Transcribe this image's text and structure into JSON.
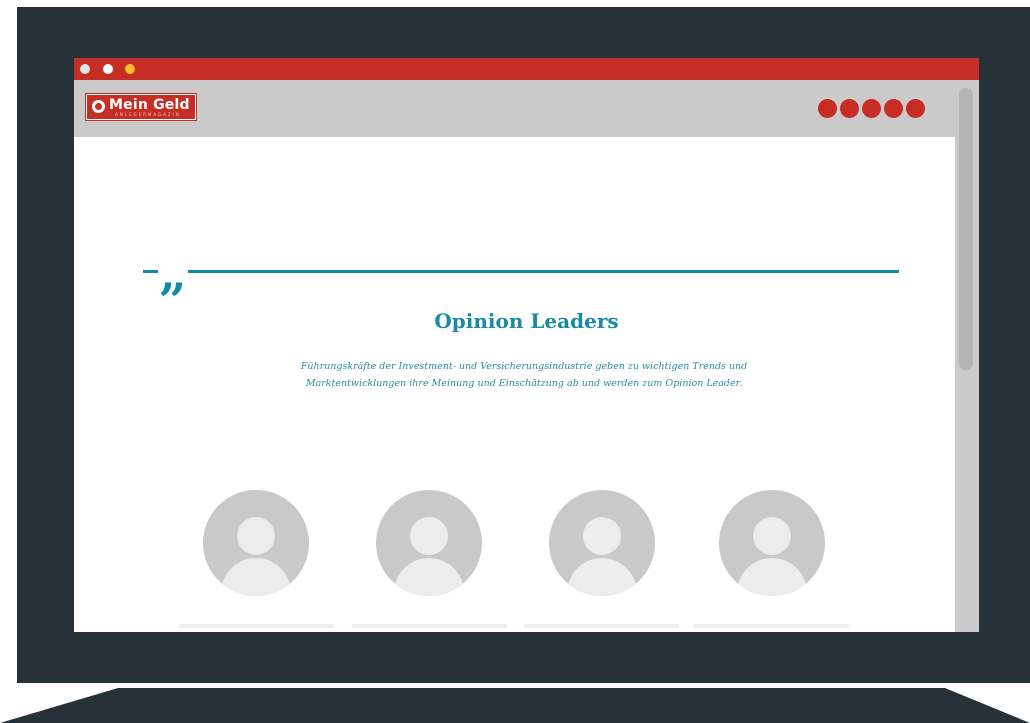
{
  "browser": {
    "window_controls": [
      "close",
      "minimize",
      "maximize"
    ]
  },
  "header": {
    "logo_text": "Mein Geld",
    "logo_subtext": "ANLEGERMAGAZIN",
    "menu_dot_count": 5
  },
  "page": {
    "quote_icon": "„",
    "title": "Opinion Leaders",
    "lead_line_1": "Führungskräfte der Investment- und Versicherungsindustrie geben zu wichtigen Trends und",
    "lead_line_2": "Marktentwicklungen ihre Meinung und Einschätzung ab und werden zum Opinion Leader."
  },
  "cards": [
    {
      "avatar": "person-placeholder-icon"
    },
    {
      "avatar": "person-placeholder-icon"
    },
    {
      "avatar": "person-placeholder-icon"
    },
    {
      "avatar": "person-placeholder-icon"
    }
  ],
  "colors": {
    "frame": "#263238",
    "brand_red": "#c62d25",
    "header_gray": "#cacaca",
    "accent_teal": "#0e8ba7",
    "placeholder_gray": "#c9c9c9"
  }
}
